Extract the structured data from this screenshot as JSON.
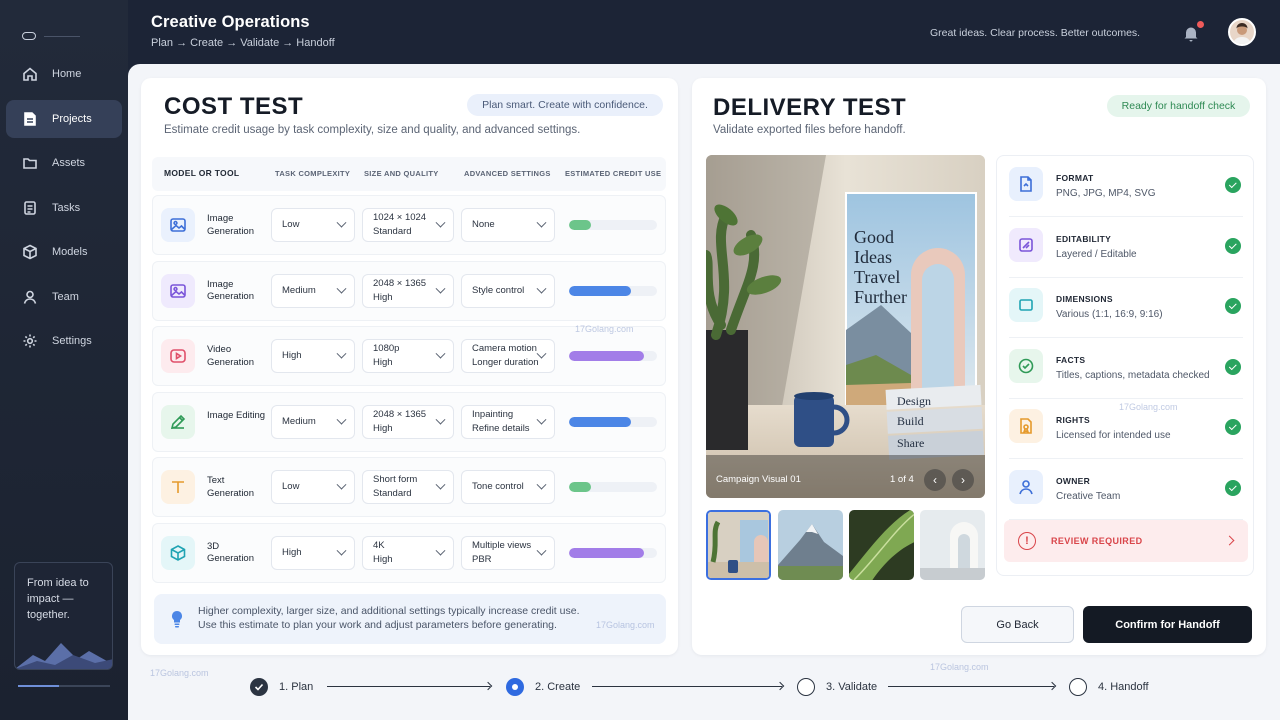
{
  "app": {
    "title": "Creative Operations",
    "breadcrumb": "Plan → Create → Validate → Handoff",
    "tagline": "Great ideas. Clear process. Better outcomes."
  },
  "sidebar": {
    "items": [
      {
        "label": "Home",
        "icon": "home-icon"
      },
      {
        "label": "Projects",
        "icon": "document-icon",
        "active": true
      },
      {
        "label": "Assets",
        "icon": "folder-icon"
      },
      {
        "label": "Tasks",
        "icon": "tasks-icon"
      },
      {
        "label": "Models",
        "icon": "cube-icon"
      },
      {
        "label": "Team",
        "icon": "user-icon"
      },
      {
        "label": "Settings",
        "icon": "gear-icon"
      }
    ],
    "promo": "From idea to impact — together.",
    "progress": 0.45
  },
  "cost": {
    "title": "COST TEST",
    "subtitle": "Estimate credit usage by task complexity, size and quality, and advanced settings.",
    "pill": "Plan smart. Create with confidence.",
    "columns": [
      "MODEL OR TOOL",
      "TASK COMPLEXITY",
      "SIZE AND QUALITY",
      "ADVANCED SETTINGS",
      "ESTIMATED CREDIT USE"
    ],
    "rows": [
      {
        "name": "Image Generation",
        "icon": "image-icon",
        "complexity": "Low",
        "size1": "1024 × 1024",
        "size2": "Standard",
        "adv1": "None",
        "adv2": "",
        "credit": 0.25,
        "color": "#6cc58a",
        "tint": "#eaf1fd",
        "stroke": "#3d6fd8"
      },
      {
        "name": "Image Generation",
        "icon": "image-icon",
        "complexity": "Medium",
        "size1": "2048 × 1365",
        "size2": "High",
        "adv1": "Style control",
        "adv2": "",
        "credit": 0.7,
        "color": "#4c86e6",
        "tint": "#efeafd",
        "stroke": "#7a55d9"
      },
      {
        "name": "Video Generation",
        "icon": "video-icon",
        "complexity": "High",
        "size1": "1080p",
        "size2": "High",
        "adv1": "Camera motion",
        "adv2": "Longer duration",
        "credit": 0.85,
        "color": "#a27de8",
        "tint": "#fdebee",
        "stroke": "#e04f6a"
      },
      {
        "name": "Image Editing",
        "icon": "pencil-icon",
        "complexity": "Medium",
        "size1": "2048 × 1365",
        "size2": "High",
        "adv1": "Inpainting",
        "adv2": "Refine details",
        "credit": 0.7,
        "color": "#4c86e6",
        "tint": "#e7f6ec",
        "stroke": "#2f9a57"
      },
      {
        "name": "Text Generation",
        "icon": "text-icon",
        "complexity": "Low",
        "size1": "Short form",
        "size2": "Standard",
        "adv1": "Tone control",
        "adv2": "",
        "credit": 0.25,
        "color": "#6cc58a",
        "tint": "#fdf1e2",
        "stroke": "#e59a2c"
      },
      {
        "name": "3D Generation",
        "icon": "cube-icon",
        "complexity": "High",
        "size1": "4K",
        "size2": "High",
        "adv1": "Multiple views",
        "adv2": "PBR",
        "credit": 0.85,
        "color": "#a27de8",
        "tint": "#e4f6f8",
        "stroke": "#1fa3b3"
      }
    ],
    "note1": "Higher complexity, larger size, and additional settings typically increase credit use.",
    "note2": "Use this estimate to plan your work and adjust parameters before generating."
  },
  "delivery": {
    "title": "DELIVERY TEST",
    "subtitle": "Validate exported files before handoff.",
    "pill": "Ready for handoff check",
    "preview": {
      "caption": "Campaign Visual 01",
      "count": "1 of 4",
      "poster": [
        "Good",
        "Ideas",
        "Travel",
        "Further"
      ],
      "books": [
        "Design",
        "Build",
        "Share"
      ]
    },
    "checks": [
      {
        "label": "FORMAT",
        "value": "PNG, JPG, MP4, SVG",
        "icon": "file-icon",
        "tint": "#e8f0fd",
        "stroke": "#3d6fd8"
      },
      {
        "label": "EDITABILITY",
        "value": "Layered / Editable",
        "icon": "layers-icon",
        "tint": "#f0eafd",
        "stroke": "#7a55d9"
      },
      {
        "label": "DIMENSIONS",
        "value": "Various (1:1, 16:9, 9:16)",
        "icon": "frame-icon",
        "tint": "#e4f6f8",
        "stroke": "#1fa3b3"
      },
      {
        "label": "FACTS",
        "value": "Titles, captions, metadata checked",
        "icon": "check-circle-icon",
        "tint": "#e7f6ec",
        "stroke": "#2f9a57"
      },
      {
        "label": "RIGHTS",
        "value": "Licensed for intended use",
        "icon": "license-icon",
        "tint": "#fdf1e2",
        "stroke": "#e59a2c"
      },
      {
        "label": "OWNER",
        "value": "Creative Team",
        "icon": "user-icon",
        "tint": "#e8f0fd",
        "stroke": "#3d6fd8"
      }
    ],
    "review": "REVIEW REQUIRED",
    "back": "Go Back",
    "confirm": "Confirm for Handoff"
  },
  "stepper": [
    {
      "label": "1. Plan",
      "state": "done"
    },
    {
      "label": "2. Create",
      "state": "current"
    },
    {
      "label": "3. Validate",
      "state": "todo"
    },
    {
      "label": "4. Handoff",
      "state": "todo"
    }
  ],
  "watermark": "17Golang.com"
}
